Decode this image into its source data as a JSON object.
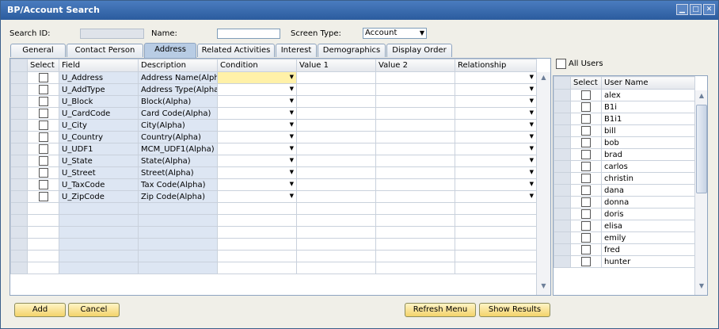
{
  "window": {
    "title": "BP/Account Search"
  },
  "header": {
    "search_id_label": "Search ID:",
    "search_id_value": "",
    "name_label": "Name:",
    "name_value": "",
    "screen_type_label": "Screen Type:",
    "screen_type_value": "Account"
  },
  "tabs": [
    "General",
    "Contact Person",
    "Address",
    "Related Activities",
    "Interest",
    "Demographics",
    "Display Order"
  ],
  "active_tab": "Address",
  "grid": {
    "columns": [
      "Select",
      "Field",
      "Description",
      "Condition",
      "Value 1",
      "Value 2",
      "Relationship"
    ],
    "rows": [
      {
        "field": "U_Address",
        "description": "Address Name(Alpha)"
      },
      {
        "field": "U_AddType",
        "description": "Address Type(Alpha)"
      },
      {
        "field": "U_Block",
        "description": "Block(Alpha)"
      },
      {
        "field": "U_CardCode",
        "description": "Card Code(Alpha)"
      },
      {
        "field": "U_City",
        "description": "City(Alpha)"
      },
      {
        "field": "U_Country",
        "description": "Country(Alpha)"
      },
      {
        "field": "U_UDF1",
        "description": "MCM_UDF1(Alpha)"
      },
      {
        "field": "U_State",
        "description": "State(Alpha)"
      },
      {
        "field": "U_Street",
        "description": "Street(Alpha)"
      },
      {
        "field": "U_TaxCode",
        "description": "Tax Code(Alpha)"
      },
      {
        "field": "U_ZipCode",
        "description": "Zip Code(Alpha)"
      }
    ]
  },
  "users_panel": {
    "all_users_label": "All Users",
    "columns": [
      "Select",
      "User Name"
    ],
    "users": [
      "alex",
      "B1i",
      "B1i1",
      "bill",
      "bob",
      "brad",
      "carlos",
      "christin",
      "dana",
      "donna",
      "doris",
      "elisa",
      "emily",
      "fred",
      "hunter"
    ]
  },
  "buttons": {
    "add": "Add",
    "cancel": "Cancel",
    "refresh_menu": "Refresh Menu",
    "show_results": "Show Results"
  },
  "icons": {
    "minimize": "minimize-icon",
    "maximize": "maximize-icon",
    "close": "close-icon",
    "dropdown": "chevron-down-icon"
  },
  "colors": {
    "titlebar": "#2b5c9e",
    "active_tab": "#b8cce4",
    "condition_highlight": "#fff1a8",
    "button": "#f3d36a"
  }
}
